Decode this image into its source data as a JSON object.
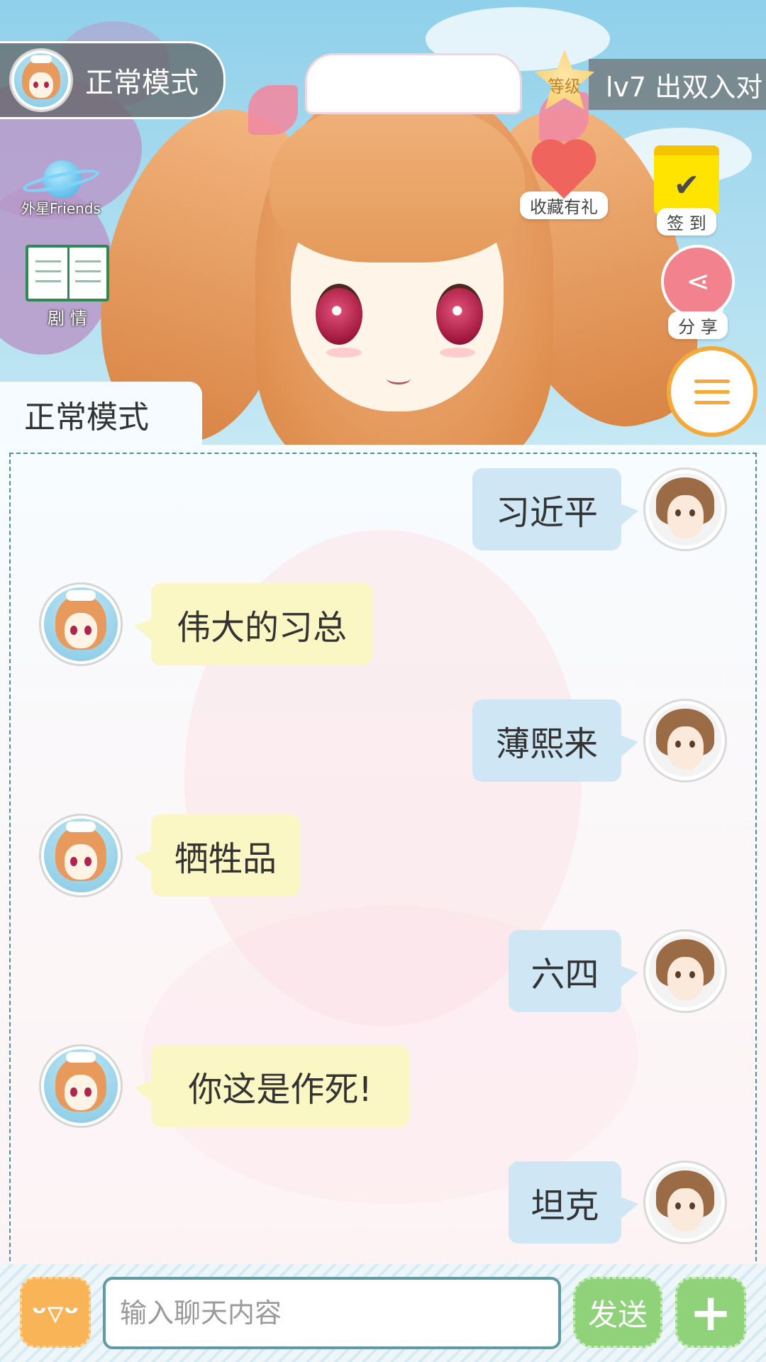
{
  "header": {
    "mode_pill_label": "正常模式",
    "level_badge": "等级",
    "level_text": "lv7 出双入对",
    "favorite_label": "收藏有礼",
    "checkin_label": "签 到",
    "share_label": "分 享",
    "friends_label": "外星Friends",
    "story_label": "剧 情",
    "mode_tab_label": "正常模式"
  },
  "chat": {
    "messages": [
      {
        "sender": "user",
        "text": "习近平"
      },
      {
        "sender": "bot",
        "text": "伟大的习总"
      },
      {
        "sender": "user",
        "text": "薄熙来"
      },
      {
        "sender": "bot",
        "text": "牺牲品"
      },
      {
        "sender": "user",
        "text": "六四"
      },
      {
        "sender": "bot",
        "text": "你这是作死!"
      },
      {
        "sender": "user",
        "text": "坦克"
      }
    ]
  },
  "input": {
    "placeholder": "输入聊天内容",
    "send_label": "发送",
    "plus_label": "+",
    "emoji_label": "ᵕ▿ᵕ"
  },
  "colors": {
    "user_bubble": "#cfe7f5",
    "bot_bubble": "#fbf7c4",
    "accent_orange": "#f4a93a",
    "send_green": "#8fd27a"
  }
}
